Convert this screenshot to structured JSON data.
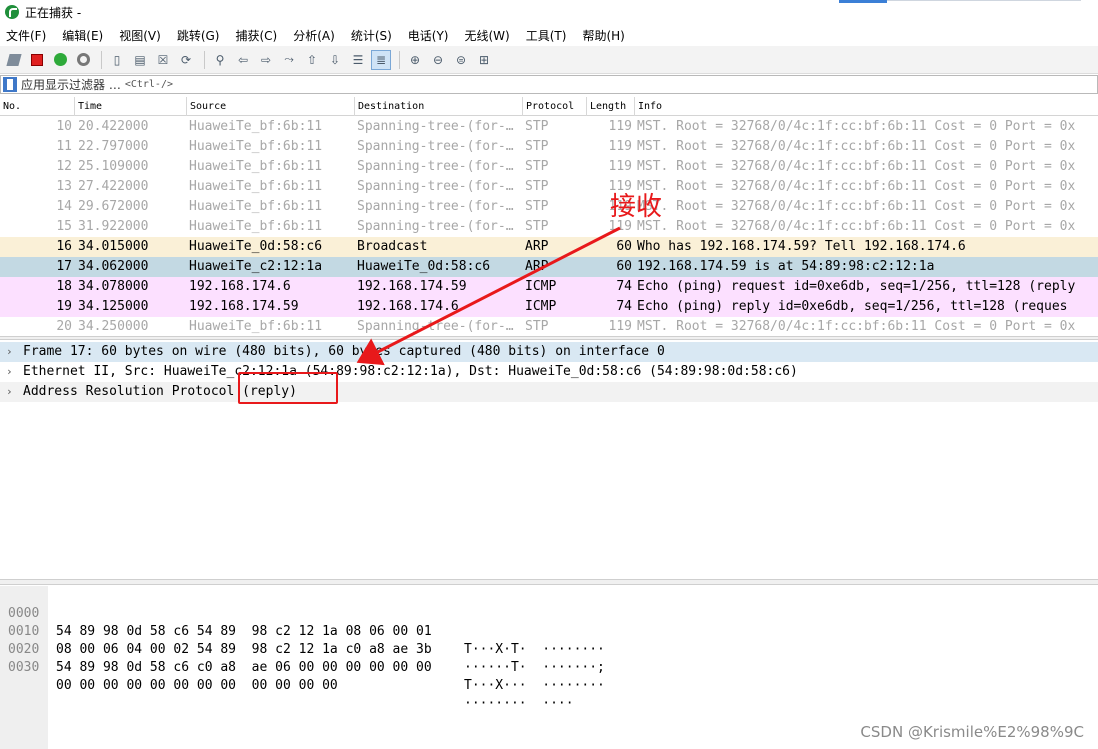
{
  "window": {
    "title": "正在捕获 -"
  },
  "menu": [
    {
      "key": "file",
      "label": "文件(F)"
    },
    {
      "key": "edit",
      "label": "编辑(E)"
    },
    {
      "key": "view",
      "label": "视图(V)"
    },
    {
      "key": "go",
      "label": "跳转(G)"
    },
    {
      "key": "capture",
      "label": "捕获(C)"
    },
    {
      "key": "analyze",
      "label": "分析(A)"
    },
    {
      "key": "statistics",
      "label": "统计(S)"
    },
    {
      "key": "telephony",
      "label": "电话(Y)"
    },
    {
      "key": "wireless",
      "label": "无线(W)"
    },
    {
      "key": "tools",
      "label": "工具(T)"
    },
    {
      "key": "help",
      "label": "帮助(H)"
    }
  ],
  "toolbar_icons": [
    "shark-fin-icon",
    "stop-capture-icon",
    "restart-capture-icon",
    "capture-options-icon",
    "open-file-icon",
    "save-file-icon",
    "close-file-icon",
    "reload-file-icon",
    "find-packet-icon",
    "go-back-icon",
    "go-forward-icon",
    "go-to-packet-icon",
    "go-first-icon",
    "go-last-icon",
    "auto-scroll-icon",
    "colorize-icon",
    "zoom-in-icon",
    "zoom-out-icon",
    "normal-size-icon",
    "resize-columns-icon"
  ],
  "filter": {
    "placeholder": "应用显示过滤器 …",
    "shortcut": "<Ctrl-/>"
  },
  "columns": [
    "No.",
    "Time",
    "Source",
    "Destination",
    "Protocol",
    "Length",
    "Info"
  ],
  "packets": [
    {
      "no": "10",
      "time": "20.422000",
      "src": "HuaweiTe_bf:6b:11",
      "dst": "Spanning-tree-(for-…",
      "proto": "STP",
      "len": "119",
      "info": "MST. Root = 32768/0/4c:1f:cc:bf:6b:11  Cost = 0  Port = 0x",
      "style": "stp"
    },
    {
      "no": "11",
      "time": "22.797000",
      "src": "HuaweiTe_bf:6b:11",
      "dst": "Spanning-tree-(for-…",
      "proto": "STP",
      "len": "119",
      "info": "MST. Root = 32768/0/4c:1f:cc:bf:6b:11  Cost = 0  Port = 0x",
      "style": "stp"
    },
    {
      "no": "12",
      "time": "25.109000",
      "src": "HuaweiTe_bf:6b:11",
      "dst": "Spanning-tree-(for-…",
      "proto": "STP",
      "len": "119",
      "info": "MST. Root = 32768/0/4c:1f:cc:bf:6b:11  Cost = 0  Port = 0x",
      "style": "stp"
    },
    {
      "no": "13",
      "time": "27.422000",
      "src": "HuaweiTe_bf:6b:11",
      "dst": "Spanning-tree-(for-…",
      "proto": "STP",
      "len": "119",
      "info": "MST. Root = 32768/0/4c:1f:cc:bf:6b:11  Cost = 0  Port = 0x",
      "style": "stp"
    },
    {
      "no": "14",
      "time": "29.672000",
      "src": "HuaweiTe_bf:6b:11",
      "dst": "Spanning-tree-(for-…",
      "proto": "STP",
      "len": "119",
      "info": "MST. Root = 32768/0/4c:1f:cc:bf:6b:11  Cost = 0  Port = 0x",
      "style": "stp"
    },
    {
      "no": "15",
      "time": "31.922000",
      "src": "HuaweiTe_bf:6b:11",
      "dst": "Spanning-tree-(for-…",
      "proto": "STP",
      "len": "119",
      "info": "MST. Root = 32768/0/4c:1f:cc:bf:6b:11  Cost = 0  Port = 0x",
      "style": "stp"
    },
    {
      "no": "16",
      "time": "34.015000",
      "src": "HuaweiTe_0d:58:c6",
      "dst": "Broadcast",
      "proto": "ARP",
      "len": "60",
      "info": "Who has 192.168.174.59? Tell 192.168.174.6",
      "style": "arp"
    },
    {
      "no": "17",
      "time": "34.062000",
      "src": "HuaweiTe_c2:12:1a",
      "dst": "HuaweiTe_0d:58:c6",
      "proto": "ARP",
      "len": "60",
      "info": "192.168.174.59 is at 54:89:98:c2:12:1a",
      "style": "arp-sel"
    },
    {
      "no": "18",
      "time": "34.078000",
      "src": "192.168.174.6",
      "dst": "192.168.174.59",
      "proto": "ICMP",
      "len": "74",
      "info": "Echo (ping) request  id=0xe6db, seq=1/256, ttl=128 (reply",
      "style": "icmp"
    },
    {
      "no": "19",
      "time": "34.125000",
      "src": "192.168.174.59",
      "dst": "192.168.174.6",
      "proto": "ICMP",
      "len": "74",
      "info": "Echo (ping) reply    id=0xe6db, seq=1/256, ttl=128 (reques",
      "style": "icmp"
    },
    {
      "no": "20",
      "time": "34.250000",
      "src": "HuaweiTe_bf:6b:11",
      "dst": "Spanning-tree-(for-…",
      "proto": "STP",
      "len": "119",
      "info": "MST. Root = 32768/0/4c:1f:cc:bf:6b:11  Cost = 0  Port = 0x",
      "style": "stp"
    }
  ],
  "details": [
    {
      "text": "Frame 17: 60 bytes on wire (480 bits), 60 bytes captured (480 bits) on interface 0",
      "style": "sel"
    },
    {
      "text": "Ethernet II, Src: HuaweiTe_c2:12:1a (54:89:98:c2:12:1a), Dst: HuaweiTe_0d:58:c6 (54:89:98:0d:58:c6)",
      "style": ""
    },
    {
      "text": "Address Resolution Protocol (reply)",
      "style": "alt"
    }
  ],
  "bytes": [
    {
      "offset": "0000",
      "hex": "54 89 98 0d 58 c6 54 89  98 c2 12 1a 08 06 00 01",
      "ascii": "T···X·T·  ········"
    },
    {
      "offset": "0010",
      "hex": "08 00 06 04 00 02 54 89  98 c2 12 1a c0 a8 ae 3b",
      "ascii": "······T·  ·······;"
    },
    {
      "offset": "0020",
      "hex": "54 89 98 0d 58 c6 c0 a8  ae 06 00 00 00 00 00 00",
      "ascii": "T···X···  ········"
    },
    {
      "offset": "0030",
      "hex": "00 00 00 00 00 00 00 00  00 00 00 00",
      "ascii": "········  ····"
    }
  ],
  "annotation": {
    "label": "接收",
    "color": "#e8191b"
  },
  "watermark": "CSDN @Krismile%E2%98%9C",
  "colors": {
    "arp_row": "#faf0d7",
    "arp_selected_row": "#c3d9e3",
    "icmp_row": "#fce0ff",
    "stp_text": "#a7a7a7"
  }
}
